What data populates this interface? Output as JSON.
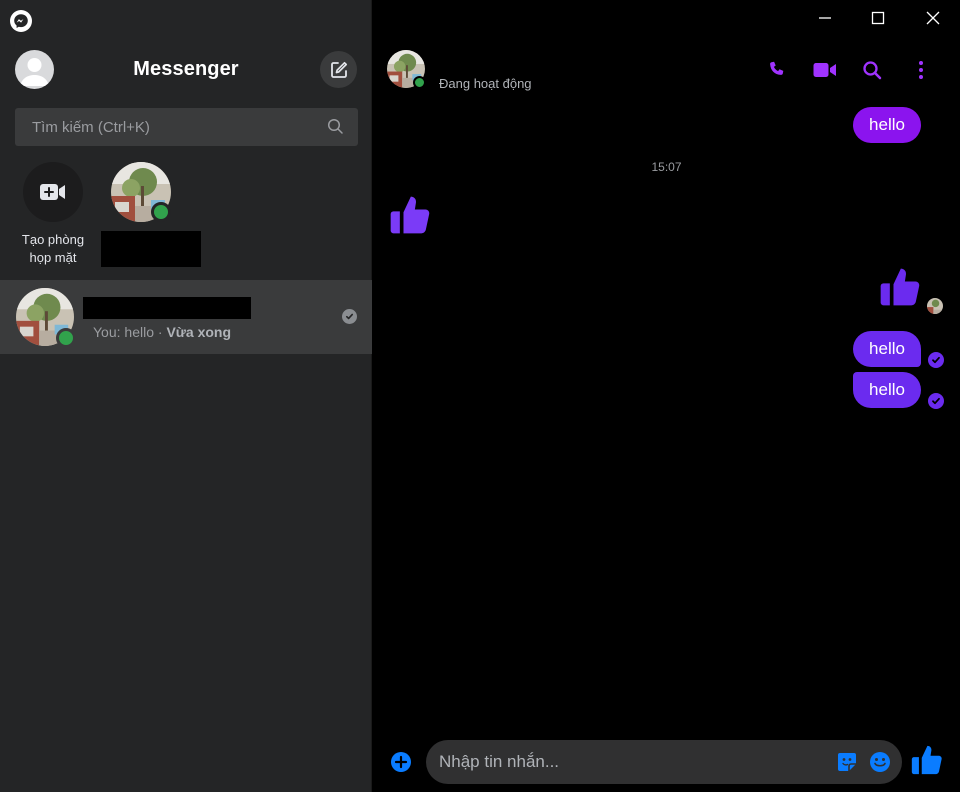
{
  "app": {
    "title": "Messenger",
    "logo_icon": "messenger-logo-icon"
  },
  "sidebar": {
    "search_placeholder": "Tìm kiếm (Ctrl+K)",
    "stories": [
      {
        "label_line1": "Tạo phòng",
        "label_line2": "họp mặt",
        "icon": "video-plus-icon"
      },
      {
        "label": "",
        "online": true
      }
    ],
    "conversation": {
      "name": "",
      "preview_prefix": "You: hello · ",
      "preview_time": "Vừa xong",
      "online": true
    }
  },
  "window_controls": {
    "minimize": "minimize-icon",
    "maximize": "maximize-icon",
    "close": "close-icon"
  },
  "chat": {
    "header": {
      "status": "Đang hoạt động",
      "online": true
    },
    "messages": [
      {
        "type": "text",
        "from": "me",
        "text": "hello"
      },
      {
        "type": "timestamp",
        "text": "15:07"
      },
      {
        "type": "like",
        "from": "them"
      },
      {
        "type": "like",
        "from": "me"
      },
      {
        "type": "text",
        "from": "me",
        "text": "hello"
      },
      {
        "type": "text",
        "from": "me",
        "text": "hello"
      }
    ],
    "composer": {
      "placeholder": "Nhập tin nhắn..."
    }
  },
  "colors": {
    "accent": "#a033ff",
    "bubble_primary": "#8b14ee",
    "bubble_secondary": "#6b2bef",
    "online": "#31a24c",
    "composer_icons": "#0a7cff"
  }
}
